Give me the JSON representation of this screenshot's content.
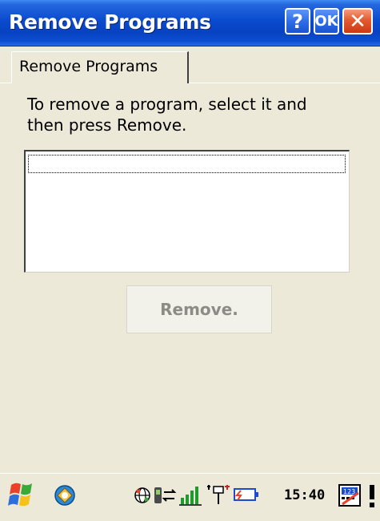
{
  "window": {
    "title": "Remove Programs",
    "help_label": "?",
    "ok_label": "OK",
    "close_label": "✕"
  },
  "tab": {
    "label": "Remove Programs"
  },
  "instruction": {
    "line1": "To remove a program, select it and",
    "line2": "then press Remove."
  },
  "program_list": {
    "items": []
  },
  "remove_button": {
    "label": "Remove.",
    "enabled": false
  },
  "taskbar": {
    "clock": "15:40",
    "icons": [
      "start-flag-icon",
      "app-icon",
      "network-globe-icon",
      "device-sync-icon",
      "signal-strength-icon",
      "antenna-icon",
      "battery-icon",
      "keyboard-123-icon",
      "input-panel-icon"
    ]
  },
  "colors": {
    "titlebar_blue": "#0842c2",
    "close_red": "#e35a30",
    "face": "#ece9d8"
  }
}
